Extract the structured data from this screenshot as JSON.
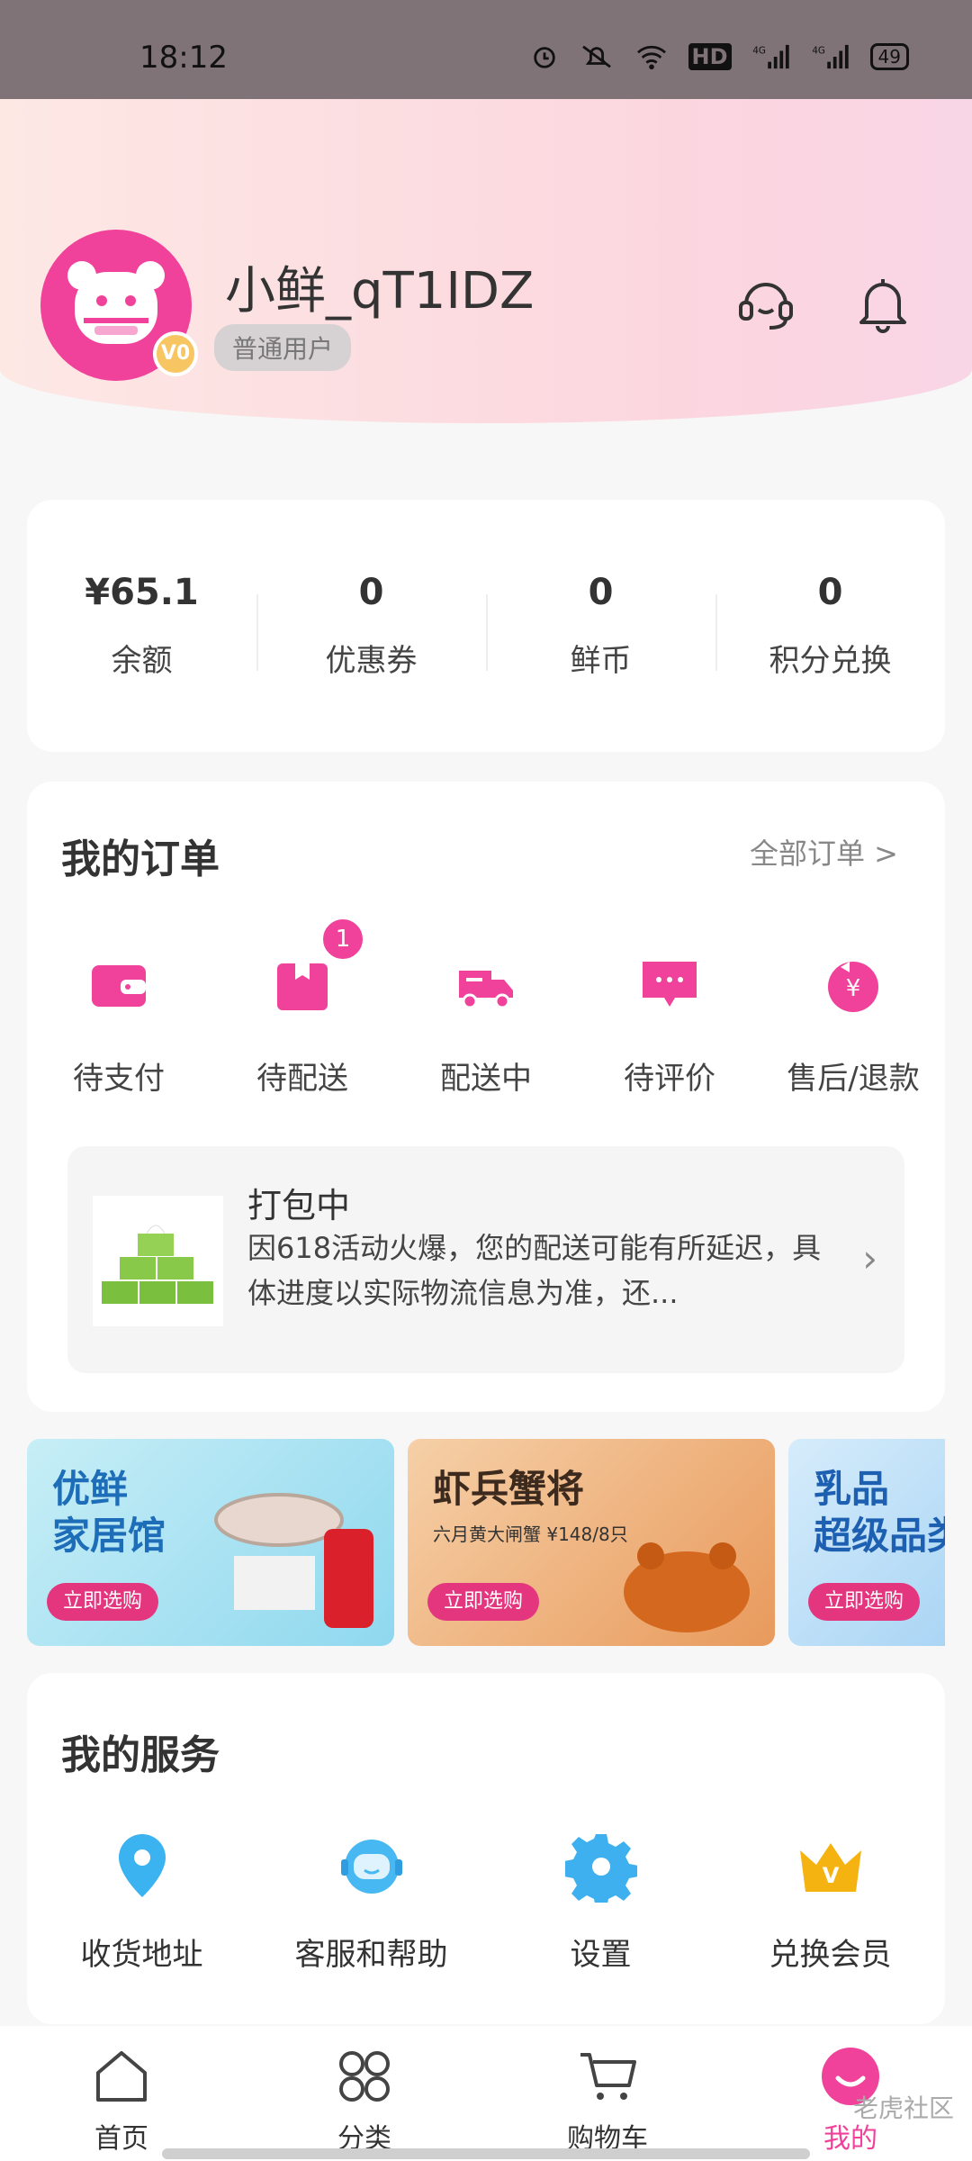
{
  "statusbar": {
    "time": "18:12",
    "battery": "49"
  },
  "profile": {
    "username": "小鲜_qT1IDZ",
    "tag": "普通用户",
    "vip_badge": "V0"
  },
  "stats": [
    {
      "value": "¥65.1",
      "label": "余额"
    },
    {
      "value": "0",
      "label": "优惠券"
    },
    {
      "value": "0",
      "label": "鲜币"
    },
    {
      "value": "0",
      "label": "积分兑换"
    }
  ],
  "orders": {
    "title": "我的订单",
    "all_label": "全部订单 >",
    "items": [
      {
        "label": "待支付",
        "icon": "wallet-icon"
      },
      {
        "label": "待配送",
        "icon": "box-icon",
        "badge": "1"
      },
      {
        "label": "配送中",
        "icon": "truck-icon"
      },
      {
        "label": "待评价",
        "icon": "comment-icon"
      },
      {
        "label": "售后/退款",
        "icon": "refund-icon"
      }
    ],
    "package": {
      "title": "打包中",
      "desc": "因618活动火爆，您的配送可能有所延迟，具体进度以实际物流信息为准，还..."
    }
  },
  "banners": [
    {
      "title_line1": "优鲜",
      "title_line2": "家居馆",
      "button": "立即选购"
    },
    {
      "title_line1": "虾兵蟹将",
      "subtitle": "六月黄大闸蟹 ¥148/8只",
      "button": "立即选购"
    },
    {
      "title_line1": "乳品",
      "title_line2": "超级品类",
      "button": "立即选购"
    }
  ],
  "services": {
    "title": "我的服务",
    "items": [
      {
        "label": "收货地址",
        "icon": "location-pin-icon"
      },
      {
        "label": "客服和帮助",
        "icon": "customer-service-icon"
      },
      {
        "label": "设置",
        "icon": "gear-icon"
      },
      {
        "label": "兑换会员",
        "icon": "crown-icon"
      }
    ]
  },
  "tabbar": [
    {
      "label": "首页",
      "icon": "home-icon"
    },
    {
      "label": "分类",
      "icon": "category-icon"
    },
    {
      "label": "购物车",
      "icon": "cart-icon"
    },
    {
      "label": "我的",
      "icon": "profile-icon",
      "active": true
    }
  ],
  "watermark": "老虎社区",
  "colors": {
    "accent": "#f0429a"
  }
}
